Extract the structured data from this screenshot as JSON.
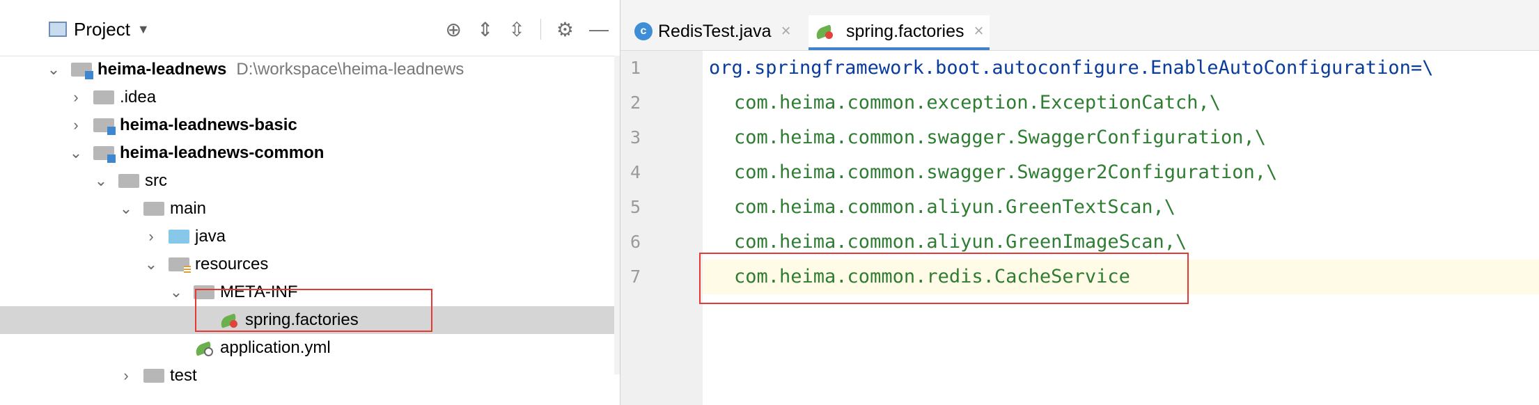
{
  "project_panel": {
    "title": "Project",
    "tree": [
      {
        "label": "heima-leadnews",
        "path": "D:\\workspace\\heima-leadnews"
      },
      {
        "label": ".idea"
      },
      {
        "label": "heima-leadnews-basic"
      },
      {
        "label": "heima-leadnews-common"
      },
      {
        "label": "src"
      },
      {
        "label": "main"
      },
      {
        "label": "java"
      },
      {
        "label": "resources"
      },
      {
        "label": "META-INF"
      },
      {
        "label": "spring.factories"
      },
      {
        "label": "application.yml"
      },
      {
        "label": "test"
      }
    ]
  },
  "editor": {
    "tabs": [
      {
        "label": "RedisTest.java",
        "active": false
      },
      {
        "label": "spring.factories",
        "active": true
      }
    ],
    "lines": [
      {
        "num": "1",
        "text": "org.springframework.boot.autoconfigure.EnableAutoConfiguration=\\"
      },
      {
        "num": "2",
        "text": "com.heima.common.exception.ExceptionCatch,\\"
      },
      {
        "num": "3",
        "text": "com.heima.common.swagger.SwaggerConfiguration,\\"
      },
      {
        "num": "4",
        "text": "com.heima.common.swagger.Swagger2Configuration,\\"
      },
      {
        "num": "5",
        "text": "com.heima.common.aliyun.GreenTextScan,\\"
      },
      {
        "num": "6",
        "text": "com.heima.common.aliyun.GreenImageScan,\\"
      },
      {
        "num": "7",
        "text": "com.heima.common.redis.CacheService"
      }
    ]
  },
  "colors": {
    "accent": "#4083c9",
    "annotation": "#e53935",
    "key_text": "#0a3c9c",
    "value_text": "#2e7d32",
    "selection": "#d5d5d5"
  }
}
